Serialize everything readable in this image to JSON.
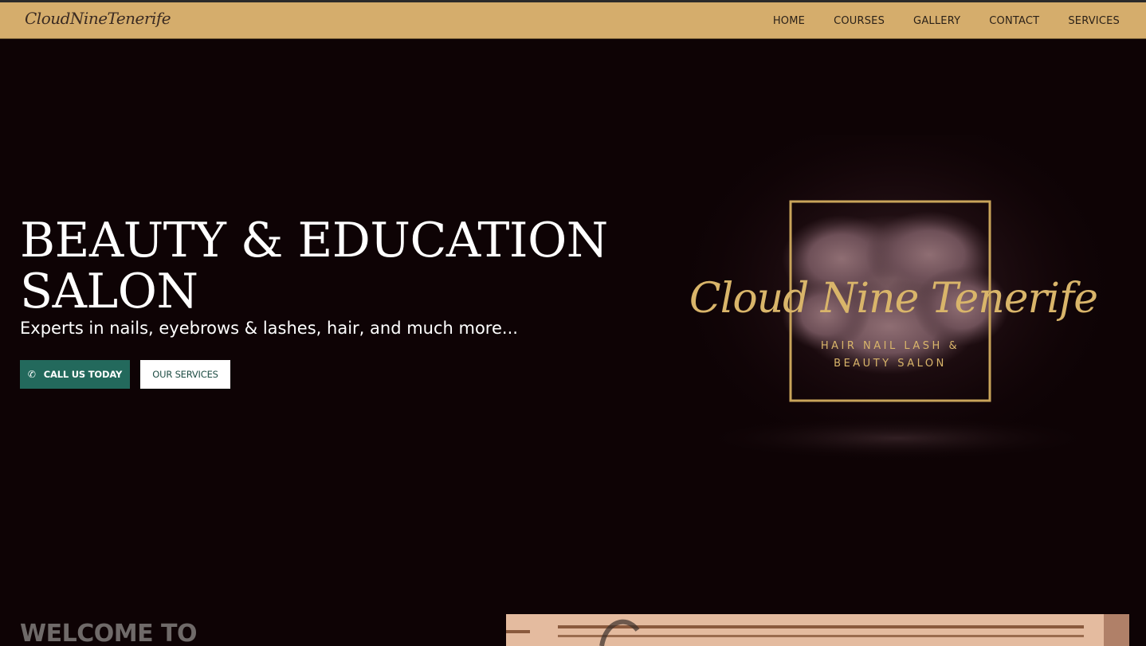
{
  "nav": {
    "logo": "CloudNineTenerife",
    "links": [
      "HOME",
      "COURSES",
      "GALLERY",
      "CONTACT",
      "SERVICES"
    ]
  },
  "hero": {
    "title": "BEAUTY & EDUCATION SALON",
    "subtitle": "Experts in nails, eyebrows & lashes, hair, and much more...",
    "call_button": "CALL US TODAY",
    "services_button": "OUR SERVICES"
  },
  "logo_art": {
    "script": "Cloud Nine Tenerife",
    "line1": "HAIR NAIL LASH &",
    "line2": "BEAUTY SALON"
  },
  "welcome": {
    "heading": "WELCOME TO"
  },
  "colors": {
    "background": "#0e0305",
    "navbar": "#d5ad6c",
    "accent_green": "#23695c",
    "gold": "#c9a45a"
  },
  "icons": {
    "call_button_icon": "phone-icon"
  }
}
